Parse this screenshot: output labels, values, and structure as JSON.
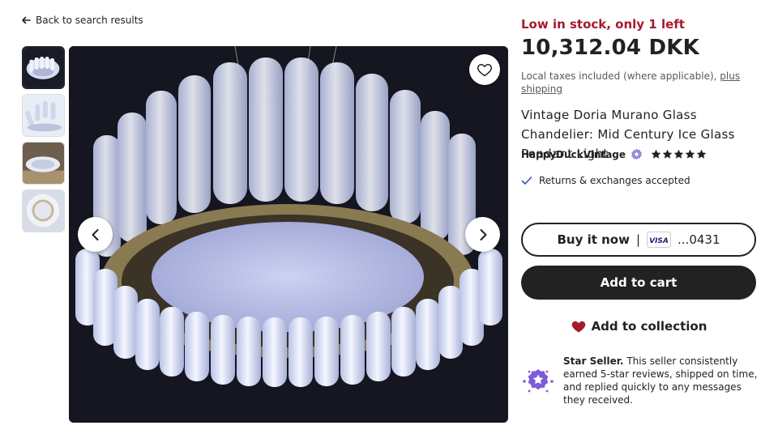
{
  "nav": {
    "back_label": "Back to search results"
  },
  "listing": {
    "stock": "Low in stock, only 1 left",
    "price": "10,312.04 DKK",
    "tax_text": "Local taxes included (where applicable),",
    "shipping_link": "plus shipping",
    "title": "Vintage Doria Murano Glass Chandelier: Mid Century Ice Glass Pendant Light",
    "seller": "HappyDuckVintage",
    "rating": 5,
    "returns": "Returns & exchanges accepted"
  },
  "actions": {
    "buy_now": "Buy it now",
    "separator": "|",
    "card_brand": "VISA",
    "card_number": "...0431",
    "add_to_cart": "Add to cart",
    "add_to_collection": "Add to collection"
  },
  "star_seller": {
    "label": "Star Seller.",
    "text": "This seller consistently earned 5-star reviews, shipped on time, and replied quickly to any messages they received."
  },
  "colors": {
    "stock": "#a61a2e",
    "primary_button": "#222222",
    "heart": "#a61a2e",
    "badge": "#7f5bd5"
  },
  "icons": [
    "back-arrow-icon",
    "heart-outline-icon",
    "chevron-left-icon",
    "chevron-right-icon",
    "star-seller-badge-icon",
    "star-icon",
    "check-icon",
    "visa-icon",
    "heart-filled-icon"
  ]
}
